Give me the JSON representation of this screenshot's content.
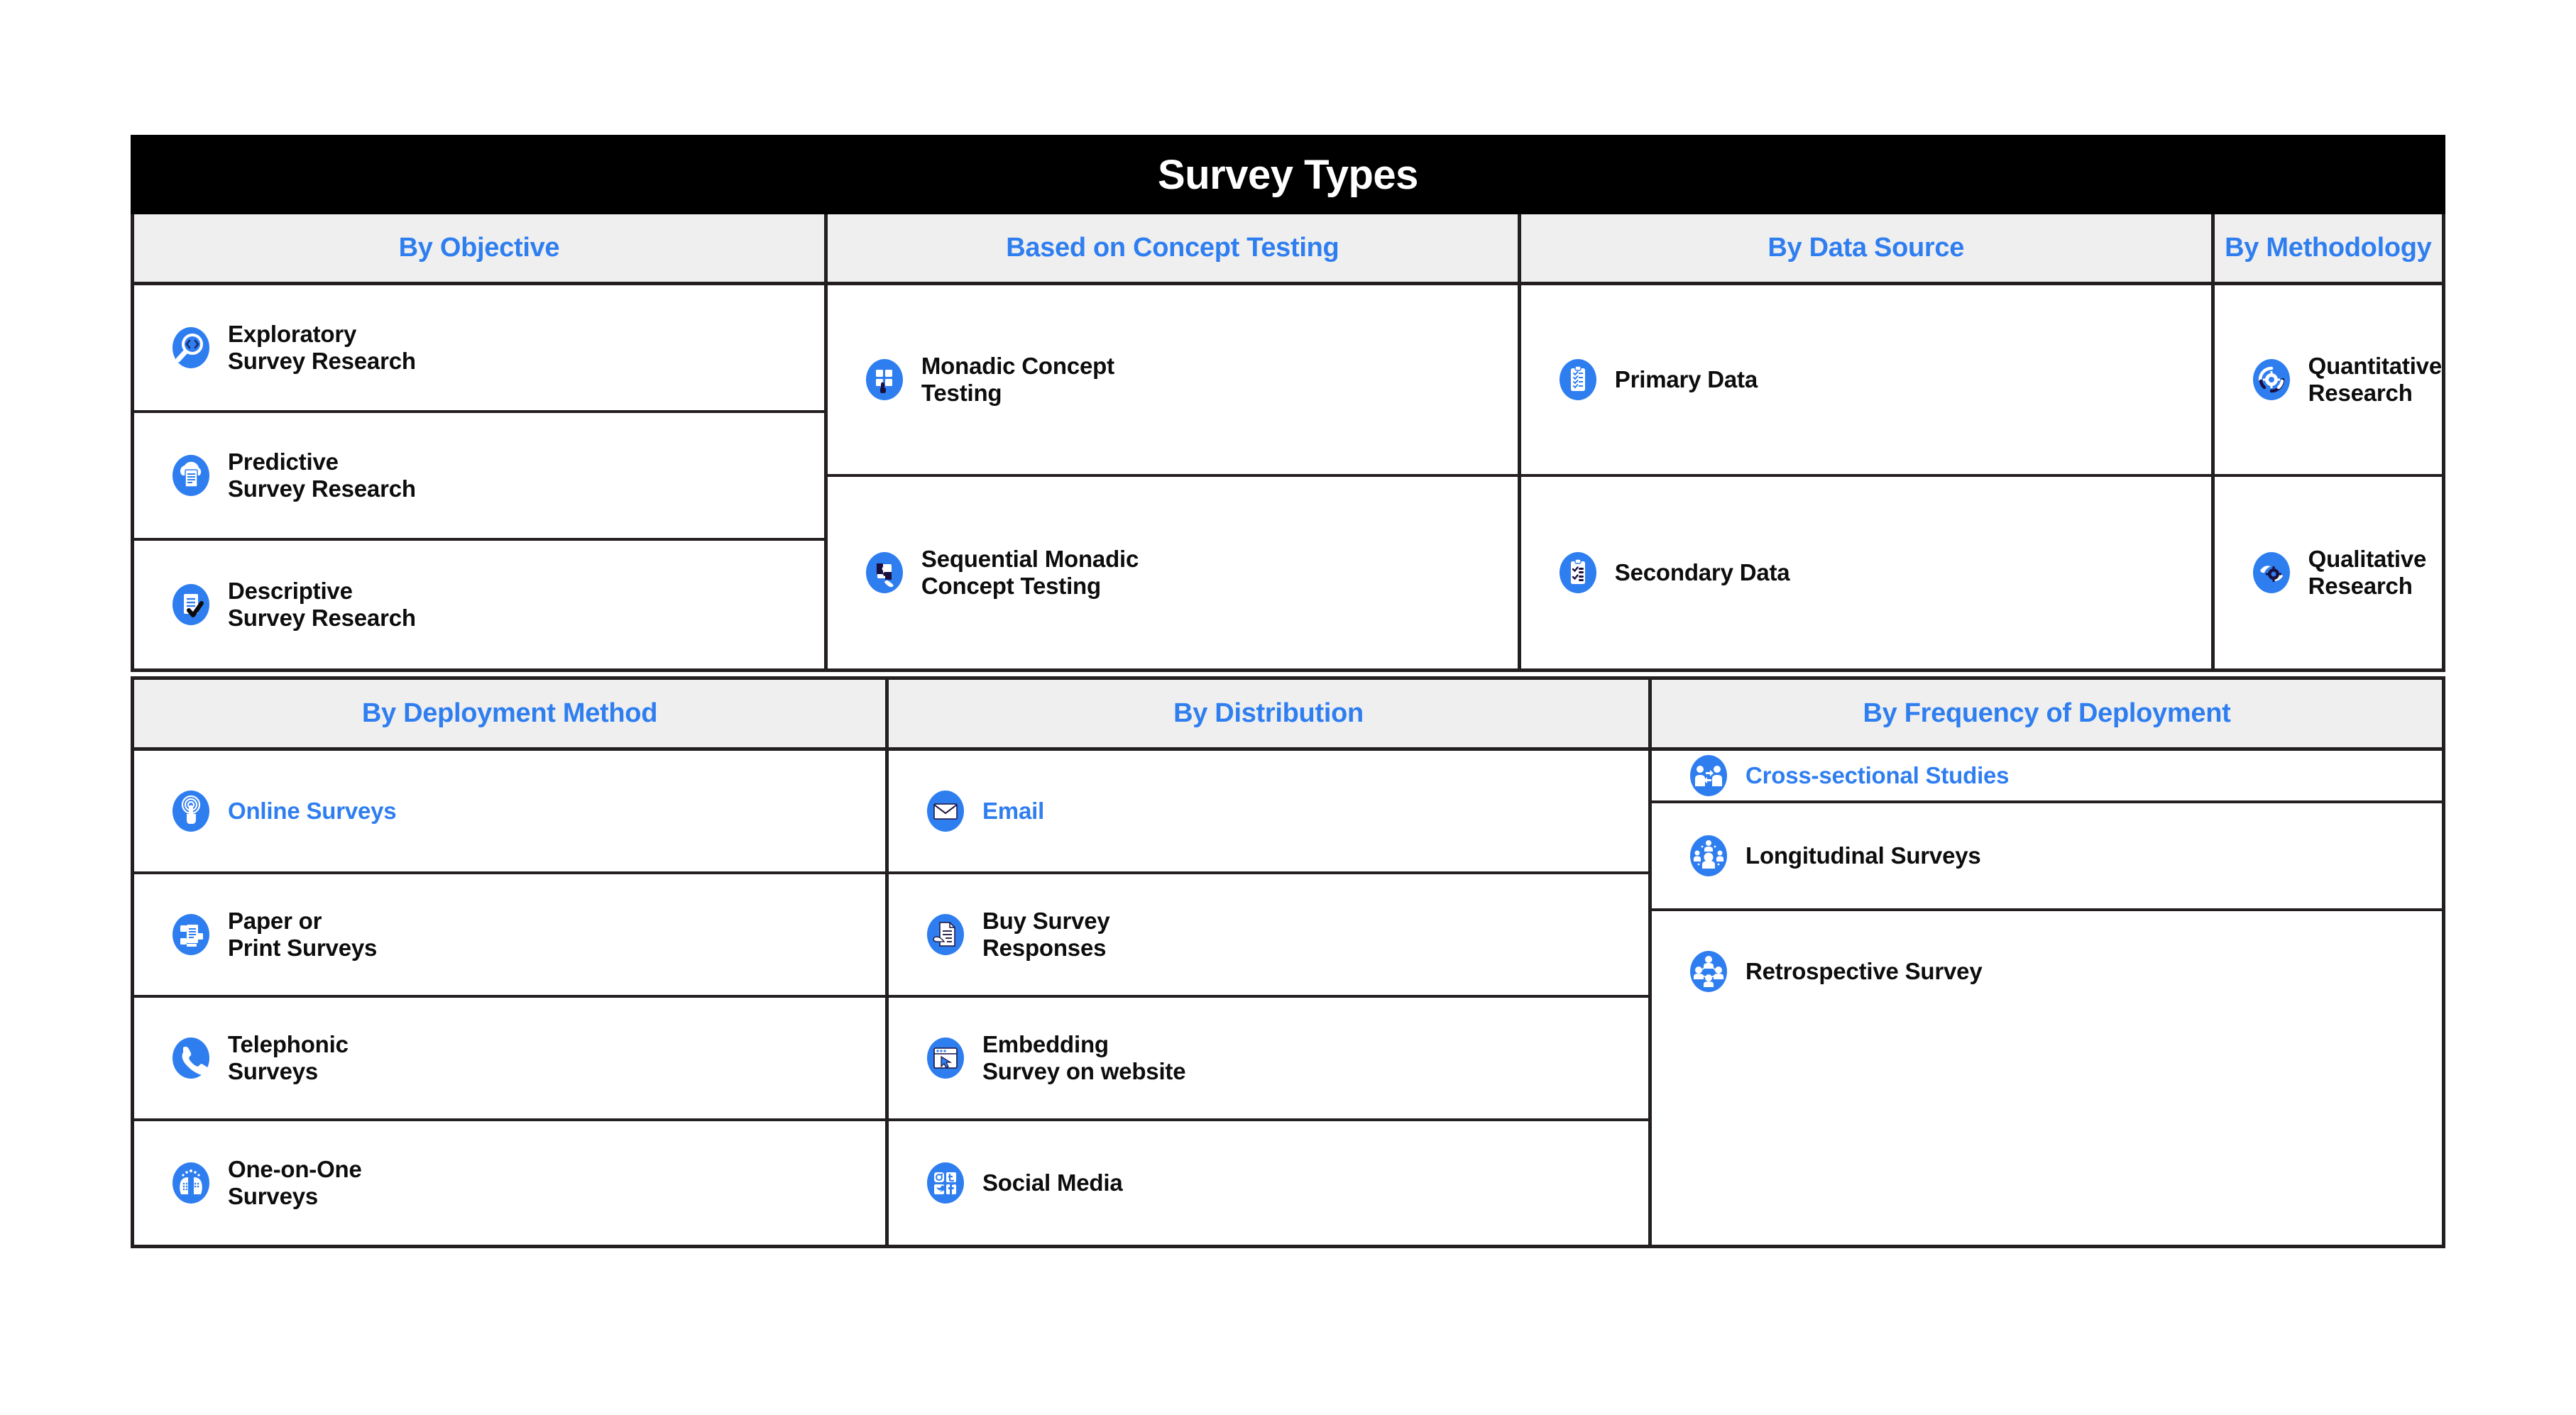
{
  "title": "Survey Types",
  "colors": {
    "accent": "#2f7ef0",
    "title_bar": "#000000",
    "header_bg": "#efefef",
    "border": "#231f20",
    "text": "#0d0d0d"
  },
  "sections": [
    {
      "name": "top",
      "columns": [
        {
          "header": "By Objective",
          "items": [
            {
              "label": "Exploratory\nSurvey Research",
              "icon": "magnifier-code-icon",
              "accent": false
            },
            {
              "label": "Predictive\nSurvey Research",
              "icon": "cloud-document-icon",
              "accent": false
            },
            {
              "label": "Descriptive\nSurvey Research",
              "icon": "document-check-icon",
              "accent": false
            }
          ]
        },
        {
          "header": "Based on Concept Testing",
          "items": [
            {
              "label": "Monadic Concept\nTesting",
              "icon": "grid-tap-icon",
              "accent": false
            },
            {
              "label": "Sequential Monadic\nConcept Testing",
              "icon": "puzzle-hand-icon",
              "accent": false
            }
          ]
        },
        {
          "header": "By Data Source",
          "items": [
            {
              "label": "Primary Data",
              "icon": "clipboard-check-icon",
              "accent": false
            },
            {
              "label": "Secondary Data",
              "icon": "clipboard-list-icon",
              "accent": false
            }
          ]
        },
        {
          "header": "By Methodology",
          "items": [
            {
              "label": "Quantitative Research",
              "icon": "gear-circle-icon",
              "accent": false
            },
            {
              "label": "Qualitative Research",
              "icon": "gear-hands-icon",
              "accent": false
            }
          ]
        }
      ]
    },
    {
      "name": "bottom",
      "columns": [
        {
          "header": "By Deployment Method",
          "items": [
            {
              "label": "Online Surveys",
              "icon": "tap-hand-icon",
              "accent": true
            },
            {
              "label": "Paper or\nPrint Surveys",
              "icon": "printer-paper-icon",
              "accent": false
            },
            {
              "label": "Telephonic\nSurveys",
              "icon": "telephone-icon",
              "accent": false
            },
            {
              "label": "One-on-One\nSurveys",
              "icon": "two-heads-icon",
              "accent": false
            }
          ]
        },
        {
          "header": "By Distribution",
          "items": [
            {
              "label": "Email",
              "icon": "envelope-icon",
              "accent": true
            },
            {
              "label": "Buy Survey\nResponses",
              "icon": "document-hand-icon",
              "accent": false
            },
            {
              "label": "Embedding\nSurvey on website",
              "icon": "browser-cursor-icon",
              "accent": false
            },
            {
              "label": "Social Media",
              "icon": "social-media-icon",
              "accent": false
            }
          ]
        },
        {
          "header": "By Frequency of Deployment",
          "items": [
            {
              "label": "Cross-sectional Studies",
              "icon": "two-people-arrows-icon",
              "accent": true
            },
            {
              "label": "Longitudinal Surveys",
              "icon": "people-network-icon",
              "accent": false
            },
            {
              "label": "Retrospective Survey",
              "icon": "people-group-icon",
              "accent": false
            }
          ]
        }
      ]
    }
  ]
}
